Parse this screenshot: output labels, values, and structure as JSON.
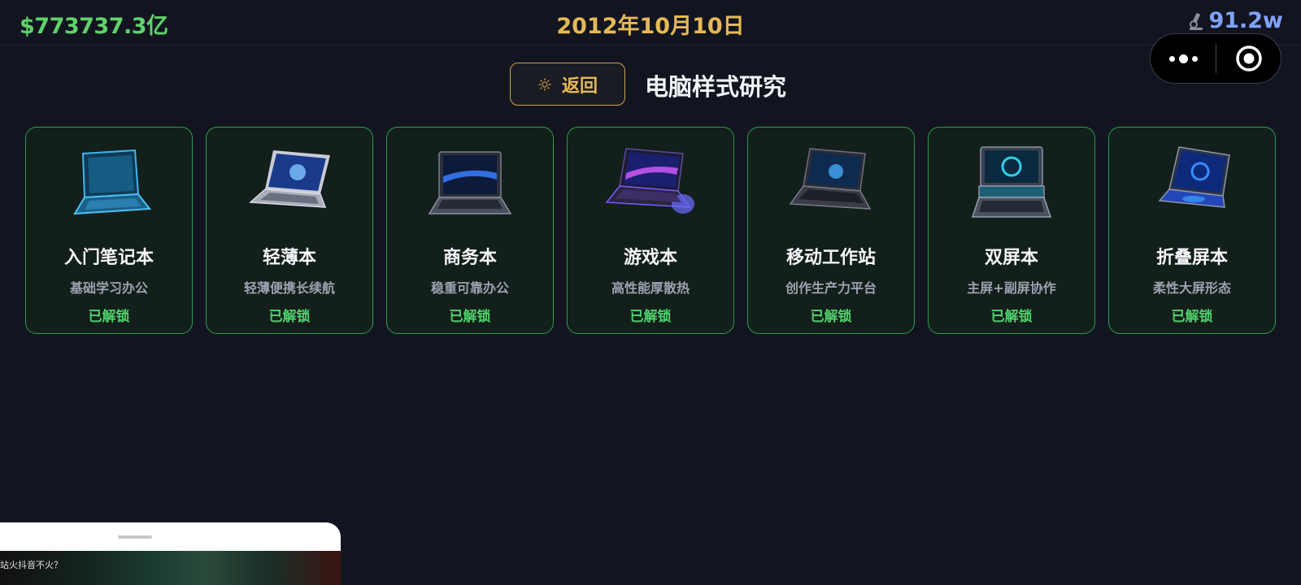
{
  "status_bar": {
    "money": "$773737.3亿",
    "date": "2012年10月10日",
    "research_points": "91.2w",
    "research_icon": "microscope-icon"
  },
  "capsule": {
    "more_icon": "more-dots-icon",
    "close_icon": "target-circle-icon"
  },
  "header": {
    "back_label": "返回",
    "back_icon": "gear-icon",
    "title": "电脑样式研究"
  },
  "cards": [
    {
      "name": "入门笔记本",
      "desc": "基础学习办公",
      "status": "已解锁",
      "image": "entry-laptop-image"
    },
    {
      "name": "轻薄本",
      "desc": "轻薄便携长续航",
      "status": "已解锁",
      "image": "ultrabook-image"
    },
    {
      "name": "商务本",
      "desc": "稳重可靠办公",
      "status": "已解锁",
      "image": "business-laptop-image"
    },
    {
      "name": "游戏本",
      "desc": "高性能厚散热",
      "status": "已解锁",
      "image": "gaming-laptop-image"
    },
    {
      "name": "移动工作站",
      "desc": "创作生产力平台",
      "status": "已解锁",
      "image": "workstation-laptop-image"
    },
    {
      "name": "双屏本",
      "desc": "主屏+副屏协作",
      "status": "已解锁",
      "image": "dual-screen-laptop-image"
    },
    {
      "name": "折叠屏本",
      "desc": "柔性大屏形态",
      "status": "已解锁",
      "image": "foldable-laptop-image"
    }
  ],
  "video_widget": {
    "caption": "站火抖音不火？"
  },
  "colors": {
    "background": "#121520",
    "money": "#5fd36a",
    "date": "#e5b955",
    "research": "#7fa3ff",
    "card_border": "#2c9c4e",
    "unlocked": "#4fd16a"
  }
}
